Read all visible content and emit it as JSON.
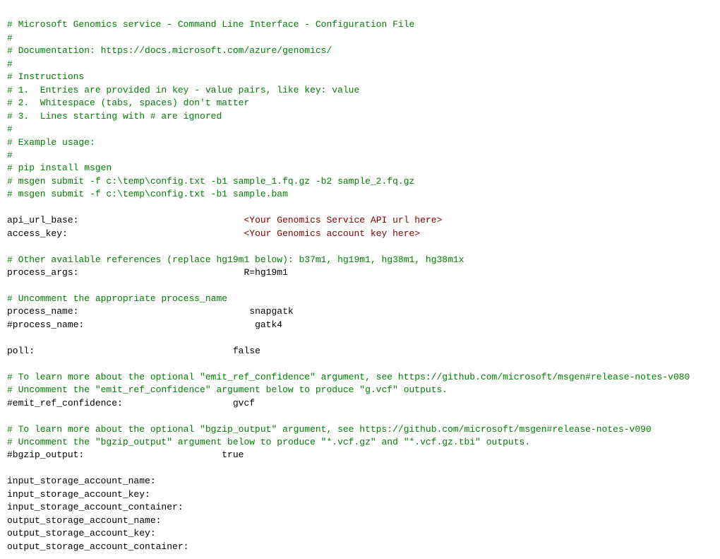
{
  "content": {
    "lines": [
      {
        "type": "comment",
        "text": "# Microsoft Genomics service - Command Line Interface - Configuration File"
      },
      {
        "type": "comment",
        "text": "#"
      },
      {
        "type": "comment",
        "text": "# Documentation: https://docs.microsoft.com/azure/genomics/"
      },
      {
        "type": "comment",
        "text": "#"
      },
      {
        "type": "comment",
        "text": "# Instructions"
      },
      {
        "type": "comment",
        "text": "# 1.  Entries are provided in key - value pairs, like key: value"
      },
      {
        "type": "comment",
        "text": "# 2.  Whitespace (tabs, spaces) don't matter"
      },
      {
        "type": "comment",
        "text": "# 3.  Lines starting with # are ignored"
      },
      {
        "type": "comment",
        "text": "#"
      },
      {
        "type": "comment",
        "text": "# Example usage:"
      },
      {
        "type": "comment",
        "text": "#"
      },
      {
        "type": "comment",
        "text": "# pip install msgen"
      },
      {
        "type": "comment",
        "text": "# msgen submit -f c:\\temp\\config.txt -b1 sample_1.fq.gz -b2 sample_2.fq.gz"
      },
      {
        "type": "comment",
        "text": "# msgen submit -f c:\\temp\\config.txt -b1 sample.bam"
      },
      {
        "type": "blank",
        "text": ""
      },
      {
        "type": "keyval_placeholder",
        "key": "api_url_base:",
        "spaces": "                              ",
        "value": "<Your Genomics Service API url here>"
      },
      {
        "type": "keyval_placeholder",
        "key": "access_key:",
        "spaces": "                                ",
        "value": "<Your Genomics account key here>"
      },
      {
        "type": "blank",
        "text": ""
      },
      {
        "type": "comment",
        "text": "# Other available references (replace hg19m1 below): b37m1, hg19m1, hg38m1, hg38m1x"
      },
      {
        "type": "keyval_normal",
        "key": "process_args:",
        "spaces": "                              ",
        "value": "R=hg19m1"
      },
      {
        "type": "blank",
        "text": ""
      },
      {
        "type": "comment",
        "text": "# Uncomment the appropriate process_name"
      },
      {
        "type": "keyval_normal",
        "key": "process_name:",
        "spaces": "                               ",
        "value": "snapgatk"
      },
      {
        "type": "keyval_normal",
        "key": "#process_name:",
        "spaces": "                              ",
        "value": " gatk4"
      },
      {
        "type": "blank",
        "text": ""
      },
      {
        "type": "keyval_normal",
        "key": "poll:",
        "spaces": "                                    ",
        "value": "false"
      },
      {
        "type": "blank",
        "text": ""
      },
      {
        "type": "comment",
        "text": "# To learn more about the optional \"emit_ref_confidence\" argument, see https://github.com/microsoft/msgen#release-notes-v080"
      },
      {
        "type": "comment",
        "text": "# Uncomment the \"emit_ref_confidence\" argument below to produce \"g.vcf\" outputs."
      },
      {
        "type": "keyval_normal",
        "key": "#emit_ref_confidence:",
        "spaces": "                    ",
        "value": "gvcf"
      },
      {
        "type": "blank",
        "text": ""
      },
      {
        "type": "comment",
        "text": "# To learn more about the optional \"bgzip_output\" argument, see https://github.com/microsoft/msgen#release-notes-v090"
      },
      {
        "type": "comment",
        "text": "# Uncomment the \"bgzip_output\" argument below to produce \"*.vcf.gz\" and \"*.vcf.gz.tbi\" outputs."
      },
      {
        "type": "keyval_normal",
        "key": "#bgzip_output:",
        "spaces": "                         ",
        "value": "true"
      },
      {
        "type": "blank",
        "text": ""
      },
      {
        "type": "key_only",
        "text": "input_storage_account_name:"
      },
      {
        "type": "key_only",
        "text": "input_storage_account_key:"
      },
      {
        "type": "key_only",
        "text": "input_storage_account_container:"
      },
      {
        "type": "key_only",
        "text": "output_storage_account_name:"
      },
      {
        "type": "key_only",
        "text": "output_storage_account_key:"
      },
      {
        "type": "key_only",
        "text": "output_storage_account_container:"
      }
    ]
  }
}
